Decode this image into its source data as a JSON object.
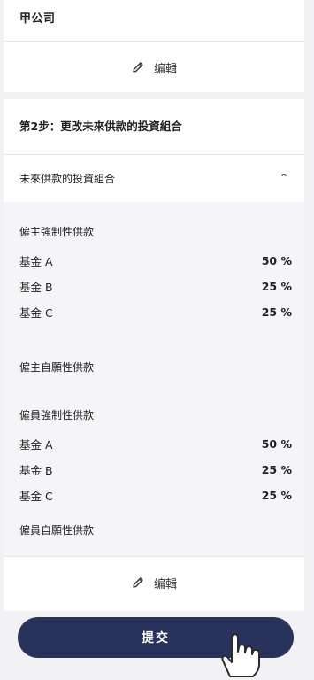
{
  "company": {
    "name": "甲公司",
    "edit_label": "编輯"
  },
  "step": {
    "title": "第2步：更改未來供款的投資組合"
  },
  "accordion": {
    "title": "未來供款的投資組合",
    "chevron": "⌃"
  },
  "sections": [
    {
      "title": "僱主強制性供款",
      "funds": [
        {
          "name": "基金 A",
          "value": "50 %"
        },
        {
          "name": "基金 B",
          "value": "25 %"
        },
        {
          "name": "基金 C",
          "value": "25 %"
        }
      ]
    },
    {
      "title": "僱主自願性供款",
      "funds": []
    },
    {
      "title": "僱員強制性供款",
      "funds": [
        {
          "name": "基金 A",
          "value": "50 %"
        },
        {
          "name": "基金 B",
          "value": "25 %"
        },
        {
          "name": "基金 C",
          "value": "25 %"
        }
      ]
    },
    {
      "title": "僱員自願性供款",
      "funds": []
    }
  ],
  "step_edit_label": "编輯",
  "submit_label": "提交",
  "colors": {
    "primary": "#28325a",
    "panel": "#f5f5f7"
  }
}
